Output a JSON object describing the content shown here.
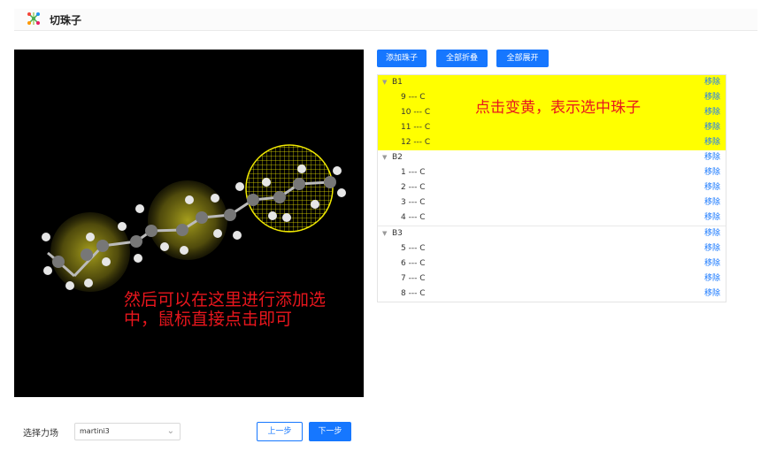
{
  "header": {
    "title": "切珠子",
    "icon": "molecule-icon"
  },
  "toolbar": {
    "add_bead": "添加珠子",
    "collapse_all": "全部折叠",
    "expand_all": "全部展开"
  },
  "viewer": {
    "note": "然后可以在这里进行添加选中，鼠标直接点击即可"
  },
  "tree": {
    "hint": "点击变黄，表示选中珠子",
    "remove_label": "移除",
    "groups": [
      {
        "name": "B1",
        "selected": true,
        "atoms": [
          "9 --- C",
          "10 --- C",
          "11 --- C",
          "12 --- C"
        ]
      },
      {
        "name": "B2",
        "selected": false,
        "atoms": [
          "1 --- C",
          "2 --- C",
          "3 --- C",
          "4 --- C"
        ]
      },
      {
        "name": "B3",
        "selected": false,
        "atoms": [
          "5 --- C",
          "6 --- C",
          "7 --- C",
          "8 --- C"
        ]
      }
    ]
  },
  "footer": {
    "forcefield_label": "选择力场",
    "forcefield_value": "martini3",
    "prev": "上一步",
    "next": "下一步"
  },
  "colors": {
    "primary": "#1677ff",
    "selected": "#ffff00",
    "annotation": "#e8161d"
  }
}
